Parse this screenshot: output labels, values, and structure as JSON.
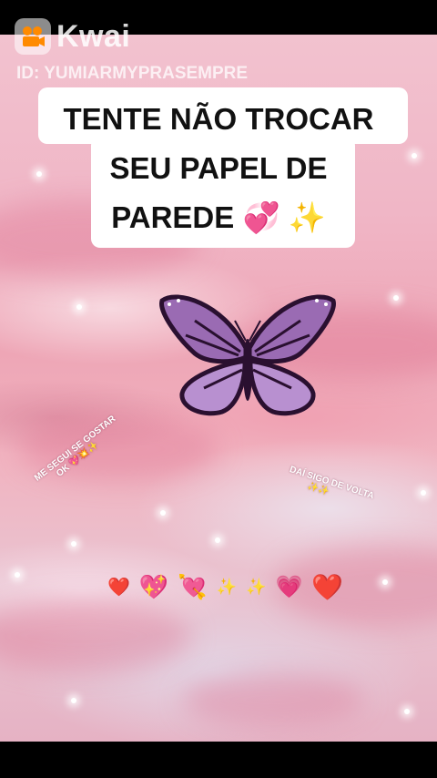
{
  "app": {
    "name": "Kwai"
  },
  "user": {
    "id_label": "ID: YUMIARMYPRASEMPRE"
  },
  "caption": {
    "line1": "TENTE NÃO TROCAR",
    "line2": "SEU PAPEL DE",
    "line3": "PAREDE",
    "line3_emojis": "💞 ✨"
  },
  "stickers": {
    "left_line1": "ME SEGUI SE GOSTAR",
    "left_line2": "OK",
    "left_emojis": "💖💥✨",
    "right_line1": "DAÍ SIGO DE VOLTA",
    "right_emojis": "✨✨"
  },
  "emoji_row": [
    "❤️",
    "💖",
    "💘",
    "✨",
    "✨",
    "💗",
    "❤️"
  ],
  "colors": {
    "accent_pink": "#f0b6c6",
    "butterfly_purple": "#9a6bb3",
    "heart_red": "#d8223a"
  }
}
